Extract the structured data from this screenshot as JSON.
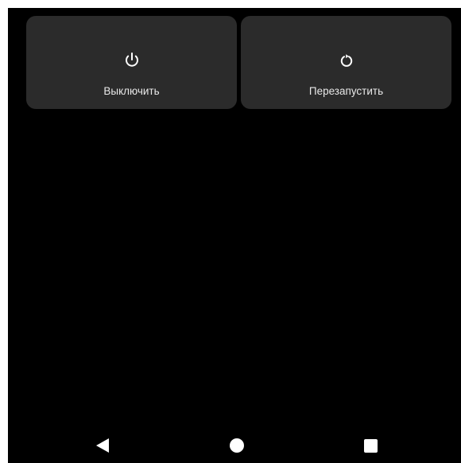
{
  "power_menu": {
    "actions": [
      {
        "label": "Выключить",
        "icon": "power-icon"
      },
      {
        "label": "Перезапустить",
        "icon": "restart-icon"
      }
    ]
  },
  "navigation_bar": {
    "back": {
      "icon": "back-triangle-icon"
    },
    "home": {
      "icon": "home-circle-icon"
    },
    "recents": {
      "icon": "recents-square-icon"
    }
  },
  "colors": {
    "background": "#000000",
    "tile": "#2b2b2b",
    "text": "#e8e8e8",
    "icon": "#ffffff"
  }
}
